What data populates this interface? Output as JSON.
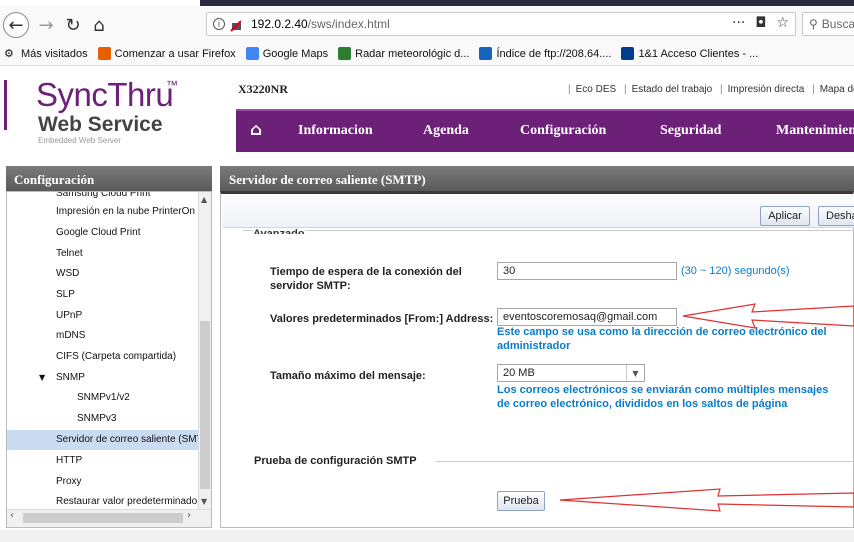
{
  "browser": {
    "url_host": "192.0.2.40",
    "url_path": "/sws/index.html",
    "search_placeholder": "Busca",
    "url_icons": [
      "more-icon",
      "pocket-icon",
      "star-icon"
    ],
    "bookmarks": [
      {
        "label": "Más visitados",
        "color": "#555555"
      },
      {
        "label": "Comenzar a usar Firefox",
        "color": "#e66000"
      },
      {
        "label": "Google Maps",
        "color": "#4285f4"
      },
      {
        "label": "Radar meteorológic d...",
        "color": "#2e7d32"
      },
      {
        "label": "Índice de ftp://208.64....",
        "color": "#1565c0"
      },
      {
        "label": "1&1 Acceso Clientes - ...",
        "color": "#003d8f"
      }
    ]
  },
  "brand": {
    "sync": "SyncThru",
    "tm": "™",
    "web_service": "Web Service",
    "embedded": "Embedded Web Server",
    "accent": "#6d2077"
  },
  "header": {
    "model": "X3220NR",
    "links": [
      "Eco DES",
      "Estado del trabajo",
      "Impresión directa",
      "Mapa del si"
    ]
  },
  "menu": {
    "home_icon": "home-icon",
    "items": [
      "Informacion",
      "Agenda",
      "Configuración",
      "Seguridad",
      "Mantenimien"
    ]
  },
  "sidebar": {
    "title": "Configuración",
    "items": [
      {
        "label": "Samsung Cloud Print",
        "level": 1
      },
      {
        "label": "Impresión en la nube PrinterOn",
        "level": 1
      },
      {
        "label": "Google Cloud Print",
        "level": 1
      },
      {
        "label": "Telnet",
        "level": 1
      },
      {
        "label": "WSD",
        "level": 1
      },
      {
        "label": "SLP",
        "level": 1
      },
      {
        "label": "UPnP",
        "level": 1
      },
      {
        "label": "mDNS",
        "level": 1
      },
      {
        "label": "CIFS (Carpeta compartida)",
        "level": 1
      },
      {
        "label": "SNMP",
        "level": 1,
        "expanded": true
      },
      {
        "label": "SNMPv1/v2",
        "level": 2
      },
      {
        "label": "SNMPv3",
        "level": 2
      },
      {
        "label": "Servidor de correo saliente (SMTP)",
        "level": 1,
        "selected": true
      },
      {
        "label": "HTTP",
        "level": 1
      },
      {
        "label": "Proxy",
        "level": 1
      },
      {
        "label": "Restaurar valor predeterminado",
        "level": 1
      }
    ]
  },
  "panel": {
    "title": "Servidor de correo saliente (SMTP)",
    "apply_label": "Aplicar",
    "undo_label": "Desha",
    "section_legend": "Avanzado",
    "timeout_label": "Tiempo de espera de la conexión del servidor SMTP:",
    "timeout_value": "30",
    "timeout_hint": "(30 ~ 120) segundo(s)",
    "from_label": "Valores predeterminados [From:] Address:",
    "from_value": "eventoscoremosaq@gmail.com",
    "from_hint": "Este campo se usa como la dirección de correo electrónico del administrador",
    "maxsize_label": "Tamaño máximo del mensaje:",
    "maxsize_value": "20 MB",
    "maxsize_hint": "Los correos electrónicos se enviarán como múltiples mensajes de correo electrónico, divididos en los saltos de página",
    "test_section_title": "Prueba de configuración SMTP",
    "test_button_label": "Prueba",
    "annotation_color": "#e0312f"
  }
}
